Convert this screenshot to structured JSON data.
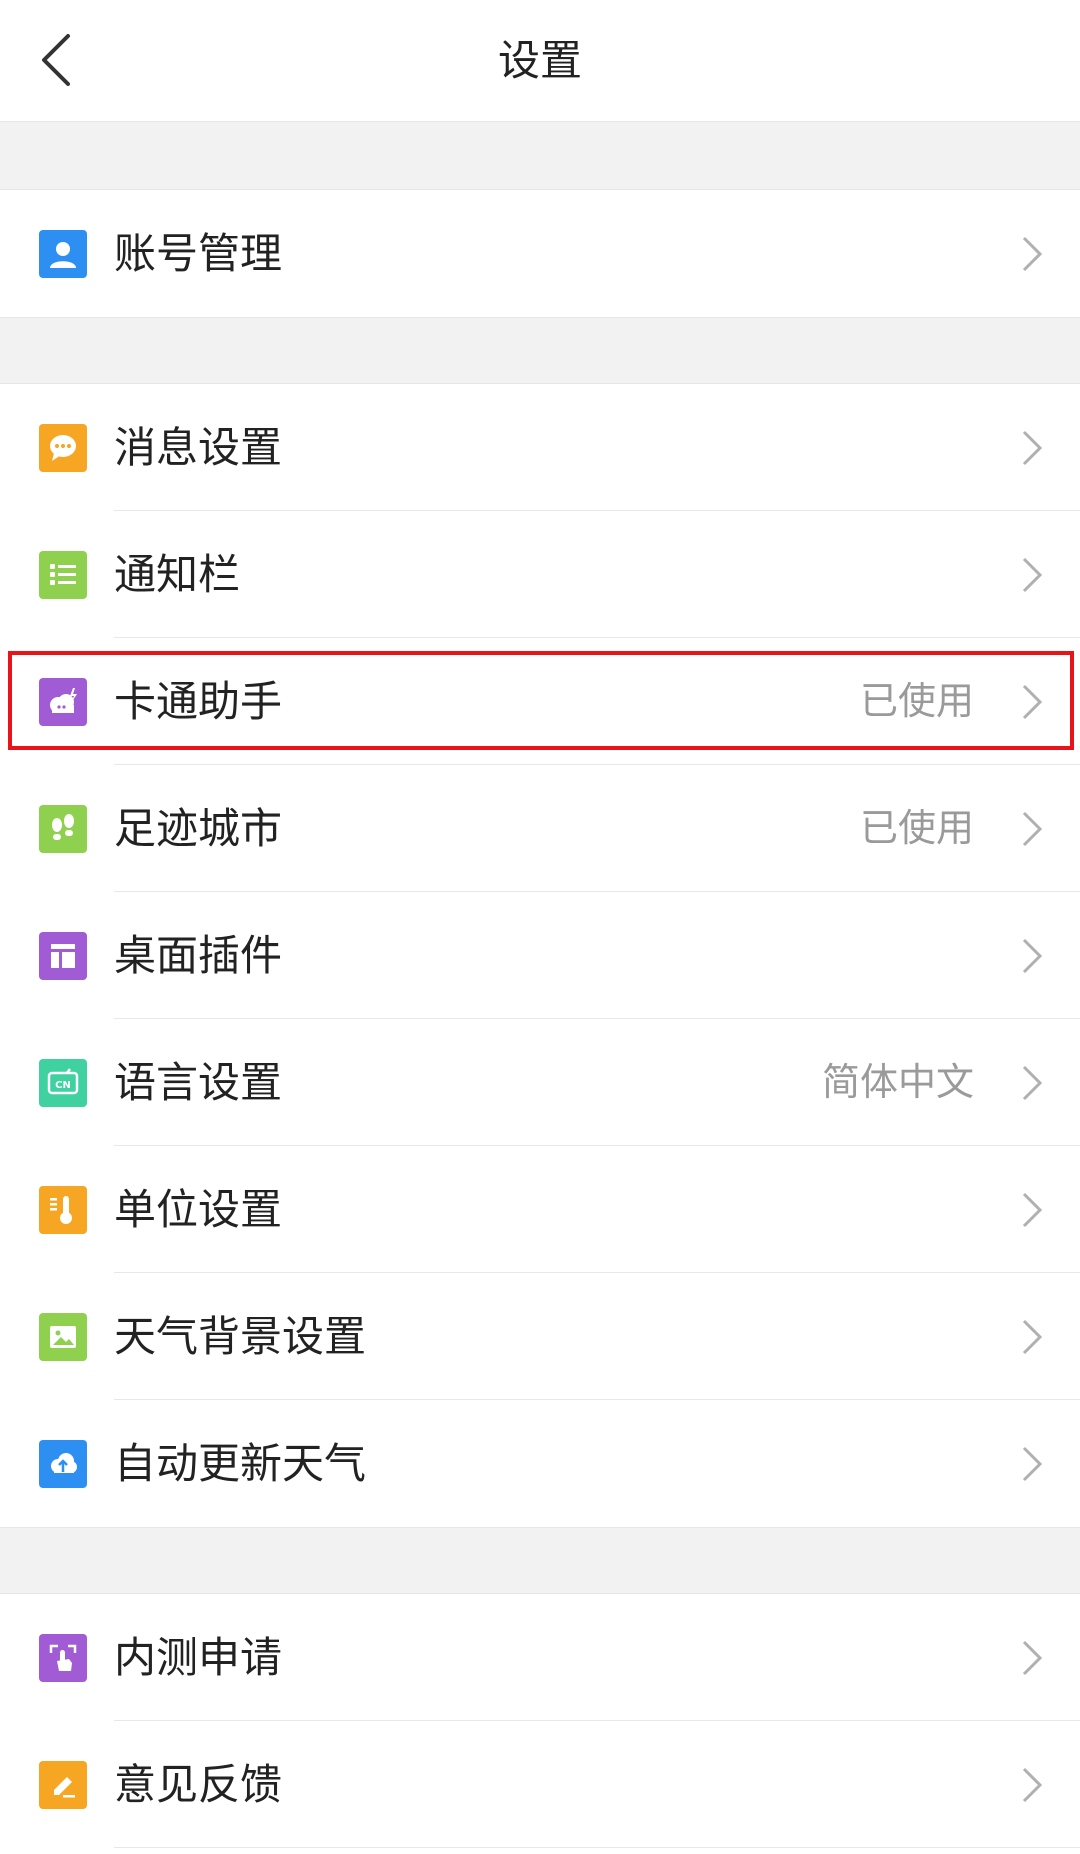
{
  "header": {
    "title": "设置",
    "back_icon": "chevron-left-icon"
  },
  "sections": [
    {
      "items": [
        {
          "label": "账号管理",
          "value": "",
          "icon": "user-icon",
          "color": "#2e8ff2"
        }
      ]
    },
    {
      "items": [
        {
          "label": "消息设置",
          "value": "",
          "icon": "chat-bubble-icon",
          "color": "#f6a623"
        },
        {
          "label": "通知栏",
          "value": "",
          "icon": "list-icon",
          "color": "#8fd14f"
        },
        {
          "label": "卡通助手",
          "value": "已使用",
          "icon": "cartoon-cloud-icon",
          "color": "#a05bd5"
        },
        {
          "label": "足迹城市",
          "value": "已使用",
          "icon": "footprints-icon",
          "color": "#8fd14f"
        },
        {
          "label": "桌面插件",
          "value": "",
          "icon": "widget-icon",
          "color": "#a05bd5"
        },
        {
          "label": "语言设置",
          "value": "简体中文",
          "icon": "cn-language-icon",
          "color": "#3fd1a0"
        },
        {
          "label": "单位设置",
          "value": "",
          "icon": "thermometer-icon",
          "color": "#f6a623"
        },
        {
          "label": "天气背景设置",
          "value": "",
          "icon": "image-icon",
          "color": "#8fd14f"
        },
        {
          "label": "自动更新天气",
          "value": "",
          "icon": "cloud-upload-icon",
          "color": "#2e8ff2"
        }
      ]
    },
    {
      "items": [
        {
          "label": "内测申请",
          "value": "",
          "icon": "touch-icon",
          "color": "#a05bd5"
        },
        {
          "label": "意见反馈",
          "value": "",
          "icon": "edit-icon",
          "color": "#f6a623"
        }
      ]
    }
  ],
  "highlight": {
    "target": "卡通助手",
    "color": "#e8141a"
  },
  "chevron_icon": "chevron-right-icon"
}
